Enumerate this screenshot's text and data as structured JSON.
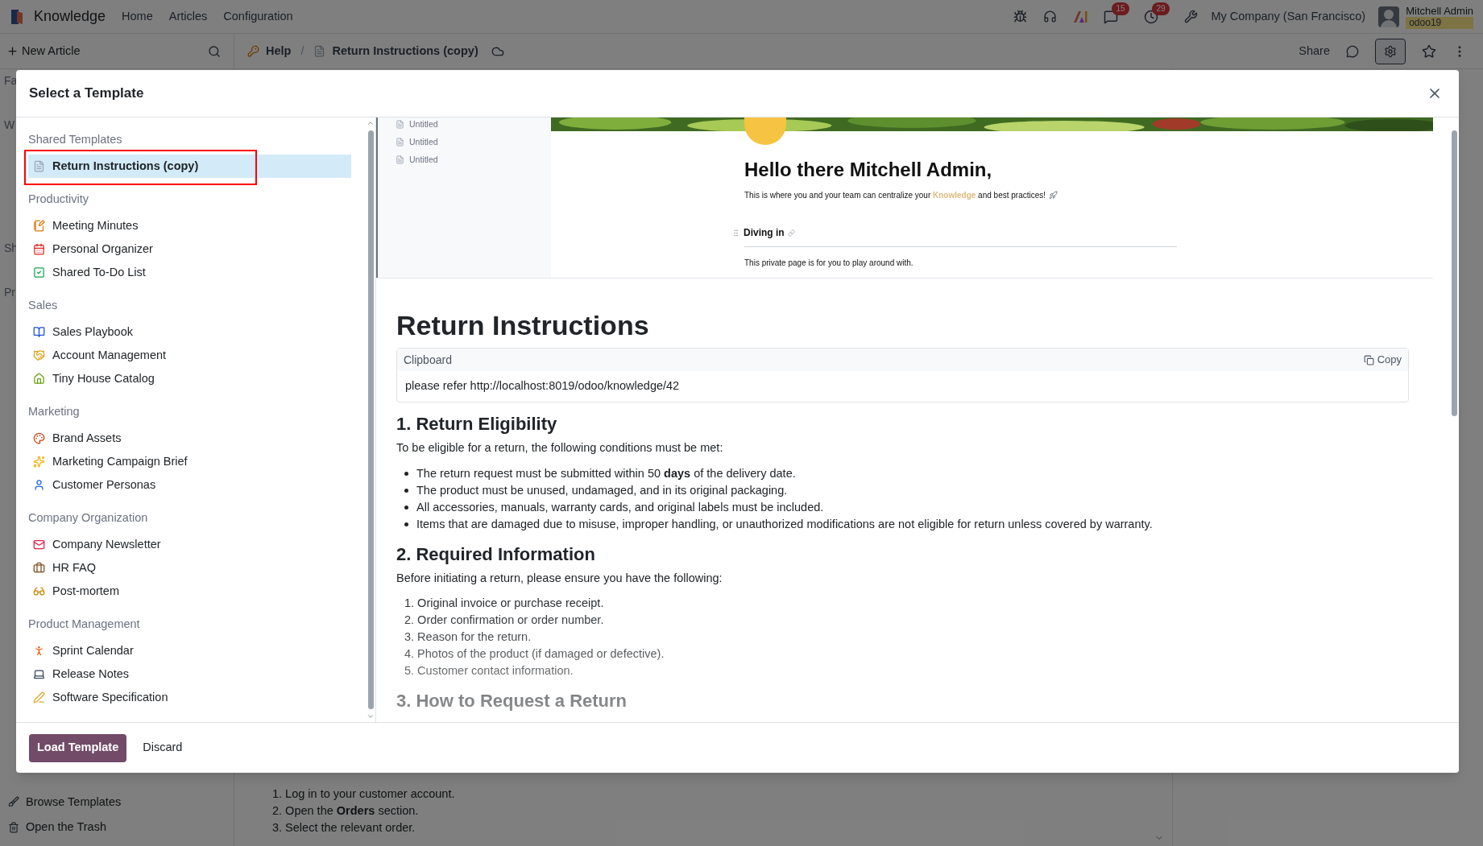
{
  "navbar": {
    "app_name": "Knowledge",
    "menu": [
      "Home",
      "Articles",
      "Configuration"
    ],
    "chat_badge": "15",
    "activity_badge": "29",
    "company": "My Company (San Francisco)",
    "user_name": "Mitchell Admin",
    "database": "odoo19"
  },
  "toolbar": {
    "new_article": "New Article",
    "separator": "/",
    "breadcrumb": [
      {
        "label": "Help",
        "kind": "key"
      },
      {
        "label": "Return Instructions (copy)",
        "kind": "page"
      }
    ],
    "share": "Share"
  },
  "sidebar": {
    "sections_cut": [
      "Fa",
      "W",
      "Sh",
      "Pr"
    ],
    "footer": [
      {
        "label": "Browse Templates",
        "kind": "brush"
      },
      {
        "label": "Open the Trash",
        "kind": "trash"
      }
    ]
  },
  "article_peek": {
    "steps": [
      "1. Log in to your customer account.",
      "2. Open the **Orders** section.",
      "3. Select the relevant order."
    ]
  },
  "dialog": {
    "title": "Select a Template",
    "groups": [
      {
        "name": "Shared Templates",
        "items": [
          {
            "label": "Return Instructions (copy)",
            "kind": "page",
            "selected": true
          }
        ]
      },
      {
        "name": "Productivity",
        "items": [
          {
            "label": "Meeting Minutes",
            "kind": "note",
            "selected": false
          },
          {
            "label": "Personal Organizer",
            "kind": "calendar",
            "selected": false
          },
          {
            "label": "Shared To-Do List",
            "kind": "check",
            "selected": false
          }
        ]
      },
      {
        "name": "Sales",
        "items": [
          {
            "label": "Sales Playbook",
            "kind": "book",
            "selected": false
          },
          {
            "label": "Account Management",
            "kind": "handshake",
            "selected": false
          },
          {
            "label": "Tiny House Catalog",
            "kind": "house",
            "selected": false
          }
        ]
      },
      {
        "name": "Marketing",
        "items": [
          {
            "label": "Brand Assets",
            "kind": "palette",
            "selected": false
          },
          {
            "label": "Marketing Campaign Brief",
            "kind": "sparkles",
            "selected": false
          },
          {
            "label": "Customer Personas",
            "kind": "person",
            "selected": false
          }
        ]
      },
      {
        "name": "Company Organization",
        "items": [
          {
            "label": "Company Newsletter",
            "kind": "mail",
            "selected": false
          },
          {
            "label": "HR FAQ",
            "kind": "briefcase",
            "selected": false
          },
          {
            "label": "Post-mortem",
            "kind": "glasses",
            "selected": false
          }
        ]
      },
      {
        "name": "Product Management",
        "items": [
          {
            "label": "Sprint Calendar",
            "kind": "runner",
            "selected": false
          },
          {
            "label": "Release Notes",
            "kind": "laptop",
            "selected": false
          },
          {
            "label": "Software Specification",
            "kind": "pen",
            "selected": false
          }
        ]
      }
    ],
    "preview": {
      "mini_sidebar": [
        "Untitled",
        "Untitled",
        "Untitled"
      ],
      "greeting": "Hello there Mitchell Admin,",
      "intro": "This is where you and your team can centralize your **Knowledge** and best practices!",
      "section": "Diving in",
      "body": "This private page is for you to play around with."
    },
    "article": {
      "title": "Return Instructions",
      "clipboard": {
        "label": "Clipboard",
        "copy": "Copy",
        "content": "please refer http://localhost:8019/odoo/knowledge/42"
      },
      "sections": [
        {
          "heading": "1. Return Eligibility",
          "intro": "To be eligible for a return, the following conditions must be met:",
          "kind": "bullet_list",
          "items": [
            "The return request must be submitted within 50 **days** of the delivery date.",
            "The product must be unused, undamaged, and in its original packaging.",
            "All accessories, manuals, warranty cards, and original labels must be included.",
            "Items that are damaged due to misuse, improper handling, or unauthorized modifications are not eligible for return unless covered by warranty."
          ]
        },
        {
          "heading": "2. Required Information",
          "intro": "Before initiating a return, please ensure you have the following:",
          "kind": "numbered_list",
          "items": [
            "1. Original invoice or purchase receipt.",
            "2. Order confirmation or order number.",
            "3. Reason for the return.",
            "4. Photos of the product (if damaged or defective).",
            "5. Customer contact information."
          ]
        },
        {
          "heading": "3. How to Request a Return",
          "kind": "heading"
        }
      ]
    },
    "buttons": {
      "primary": "Load Template",
      "secondary": "Discard"
    }
  }
}
